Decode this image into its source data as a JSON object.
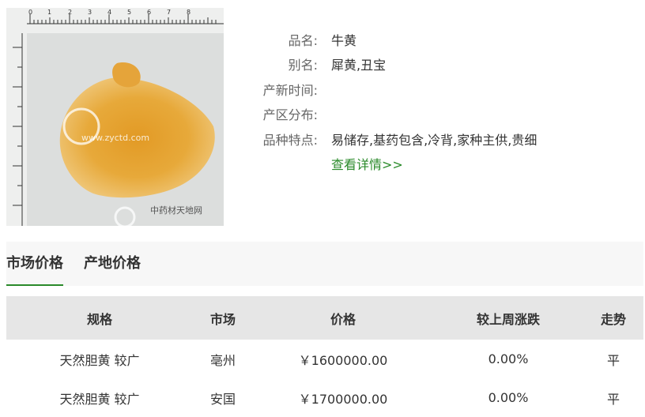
{
  "product": {
    "image_alt": "牛黄 粉末",
    "watermark_text": "中药材天地网",
    "watermark_url": "www.zyctd.com",
    "ruler_numbers": [
      "0",
      "1",
      "2",
      "3",
      "4",
      "5",
      "6",
      "7",
      "8"
    ]
  },
  "info": {
    "name_label": "品名:",
    "name_value": "牛黄",
    "alias_label": "别名:",
    "alias_value": "犀黄,丑宝",
    "update_label": "产新时间:",
    "update_value": "",
    "region_label": "产区分布:",
    "region_value": "",
    "feature_label": "品种特点:",
    "feature_value": "易储存,基药包含,冷背,家种主供,贵细",
    "more_link": "查看详情>>"
  },
  "tabs": [
    {
      "label": "市场价格",
      "active": true
    },
    {
      "label": "产地价格",
      "active": false
    }
  ],
  "table": {
    "headers": [
      "规格",
      "市场",
      "价格",
      "较上周涨跌",
      "走势"
    ],
    "rows": [
      [
        "天然胆黄 较广",
        "亳州",
        "￥1600000.00",
        "0.00%",
        "平"
      ],
      [
        "天然胆黄 较广",
        "安国",
        "￥1700000.00",
        "0.00%",
        "平"
      ]
    ]
  },
  "colors": {
    "accent_green": "#2a8a2a",
    "header_bg": "#e6e6e6",
    "tab_bar_bg": "#f7f7f7",
    "powder": "#e6a32e"
  }
}
